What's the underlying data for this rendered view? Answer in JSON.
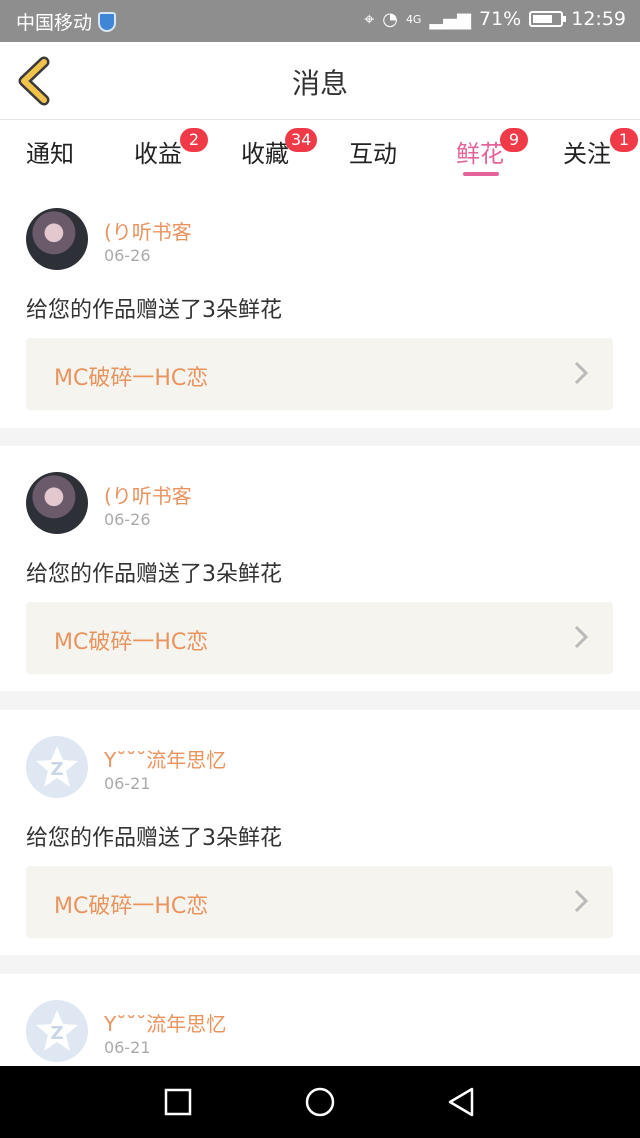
{
  "status_bar": {
    "carrier": "中国移动",
    "network": "4G",
    "battery": "71%",
    "battery_level": 0.71,
    "time": "12:59"
  },
  "header": {
    "title": "消息"
  },
  "tabs": [
    {
      "label": "通知",
      "badge": ""
    },
    {
      "label": "收益",
      "badge": "2"
    },
    {
      "label": "收藏",
      "badge": "34"
    },
    {
      "label": "互动",
      "badge": ""
    },
    {
      "label": "鲜花",
      "badge": "9",
      "active": true
    },
    {
      "label": "关注",
      "badge": "1"
    }
  ],
  "messages": [
    {
      "user": "(り听书客",
      "date": "06-26",
      "text": "给您的作品赠送了3朵鲜花",
      "work": "MC破碎一HC恋",
      "avatar": "photo"
    },
    {
      "user": "(り听书客",
      "date": "06-26",
      "text": "给您的作品赠送了3朵鲜花",
      "work": "MC破碎一HC恋",
      "avatar": "photo"
    },
    {
      "user": "Y˘˘˘流年思忆",
      "date": "06-21",
      "text": "给您的作品赠送了3朵鲜花",
      "work": "MC破碎一HC恋",
      "avatar": "qq"
    },
    {
      "user": "Y˘˘˘流年思忆",
      "date": "06-21",
      "text": "",
      "work": "",
      "avatar": "qq"
    }
  ],
  "colors": {
    "accent": "#e4639a",
    "username": "#e9935f",
    "badge": "#f03a48",
    "back_arrow": "#f2c34a"
  }
}
